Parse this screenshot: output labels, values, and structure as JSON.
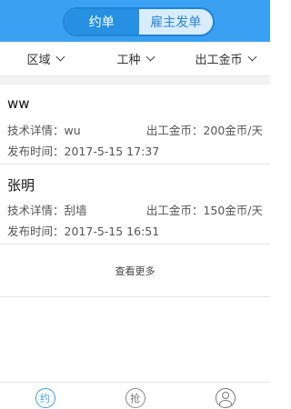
{
  "header": {
    "tabs": [
      "约单",
      "雇主发单"
    ],
    "active_tab": 0
  },
  "filters": [
    {
      "label": "区域"
    },
    {
      "label": "工种"
    },
    {
      "label": "出工金币"
    }
  ],
  "orders": [
    {
      "title": "ww",
      "skill_label": "技术详情：",
      "skill": "wu",
      "coin_label": "出工金币：",
      "coin": "200金币/天",
      "time_label": "发布时间：",
      "time": "2017-5-15 17:37"
    },
    {
      "title": "张明",
      "skill_label": "技术详情：",
      "skill": "刮墙",
      "coin_label": "出工金币：",
      "coin": "150金币/天",
      "time_label": "发布时间：",
      "time": "2017-5-15 16:51"
    }
  ],
  "more_label": "查看更多",
  "tabbar": {
    "items": [
      {
        "glyph": "约",
        "icon": "appointment-icon",
        "active": true
      },
      {
        "glyph": "抢",
        "icon": "grab-order-icon",
        "active": false
      },
      {
        "glyph": "",
        "icon": "profile-icon",
        "active": false
      }
    ]
  },
  "colors": {
    "primary": "#3aa0f1",
    "segment_active": "#2690e3",
    "segment_inactive": "#d8ecfb"
  }
}
